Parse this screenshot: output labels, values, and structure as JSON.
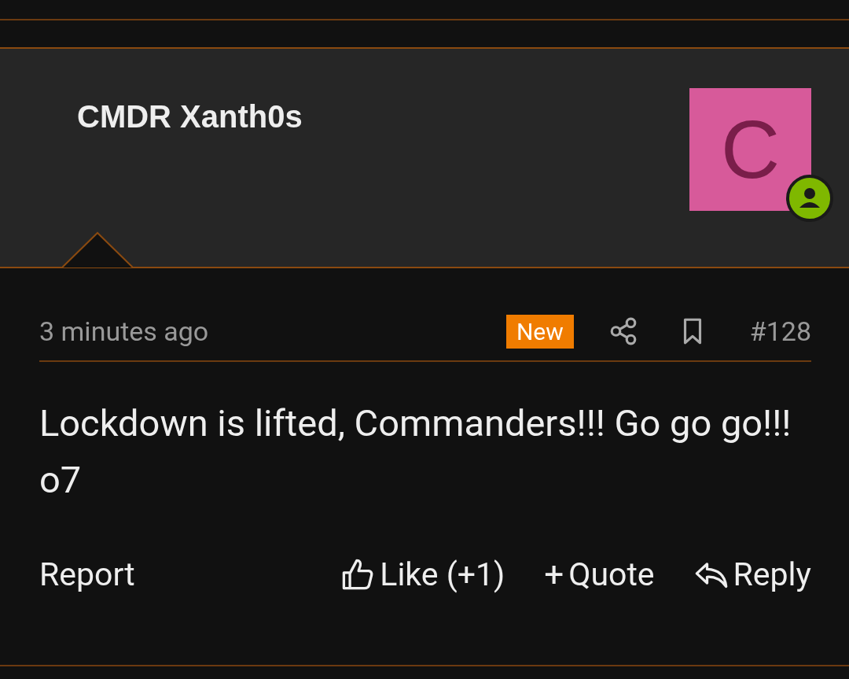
{
  "post": {
    "author": "CMDR Xanth0s",
    "avatar": {
      "letter": "C",
      "color": "#d75a9a",
      "online": true
    },
    "time": "3 minutes ago",
    "badge": "New",
    "number": "#128",
    "body": "Lockdown is lifted, Commanders!!! Go go go!!! o7",
    "actions": [
      {
        "kind": "report",
        "label": "Report"
      },
      {
        "kind": "like",
        "label": "Like (+1)"
      },
      {
        "kind": "quote",
        "label": "Quote",
        "icon": "+"
      },
      {
        "kind": "reply",
        "label": "Reply"
      }
    ]
  }
}
